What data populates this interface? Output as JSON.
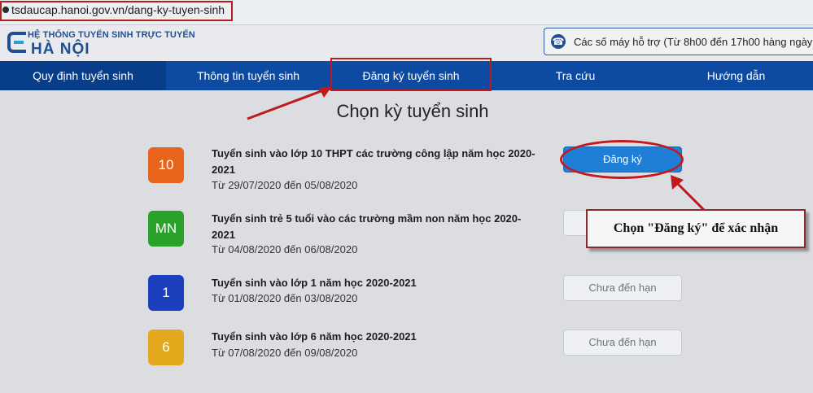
{
  "browser": {
    "url": "tsdaucap.hanoi.gov.vn/dang-ky-tuyen-sinh"
  },
  "header": {
    "logo_line1": "HỆ THỐNG TUYỂN SINH TRỰC TUYẾN",
    "logo_line2": "HÀ NỘI",
    "support_text": "Các số máy hỗ trợ (Từ 8h00 đến 17h00 hàng ngày"
  },
  "nav": {
    "items": [
      {
        "label": "Quy định tuyển sinh"
      },
      {
        "label": "Thông tin tuyển sinh"
      },
      {
        "label": "Đăng ký tuyển sinh"
      },
      {
        "label": "Tra cứu"
      },
      {
        "label": "Hướng dẫn"
      }
    ]
  },
  "main": {
    "title": "Chọn kỳ tuyển sinh",
    "items": [
      {
        "badge": "10",
        "badge_color": "#e8641b",
        "title": "Tuyển sinh vào lớp 10 THPT các trường công lập năm học 2020-2021",
        "date": "Từ 29/07/2020 đến 05/08/2020",
        "button": "Đăng ký"
      },
      {
        "badge": "MN",
        "badge_color": "#2aa22a",
        "title": "Tuyển sinh trẻ 5 tuổi vào các trường mầm non năm học 2020-2021",
        "date": "Từ 04/08/2020 đến 06/08/2020",
        "button": ""
      },
      {
        "badge": "1",
        "badge_color": "#1c3fbe",
        "title": "Tuyển sinh vào lớp 1 năm học 2020-2021",
        "date": "Từ 01/08/2020 đến 03/08/2020",
        "button": "Chưa đến hạn"
      },
      {
        "badge": "6",
        "badge_color": "#e3a81b",
        "title": "Tuyển sinh vào lớp 6 năm học 2020-2021",
        "date": "Từ 07/08/2020 đến 09/08/2020",
        "button": "Chưa đến hạn"
      }
    ]
  },
  "annotation": {
    "callout": "Chọn \"Đăng ký\" để xác nhận"
  }
}
